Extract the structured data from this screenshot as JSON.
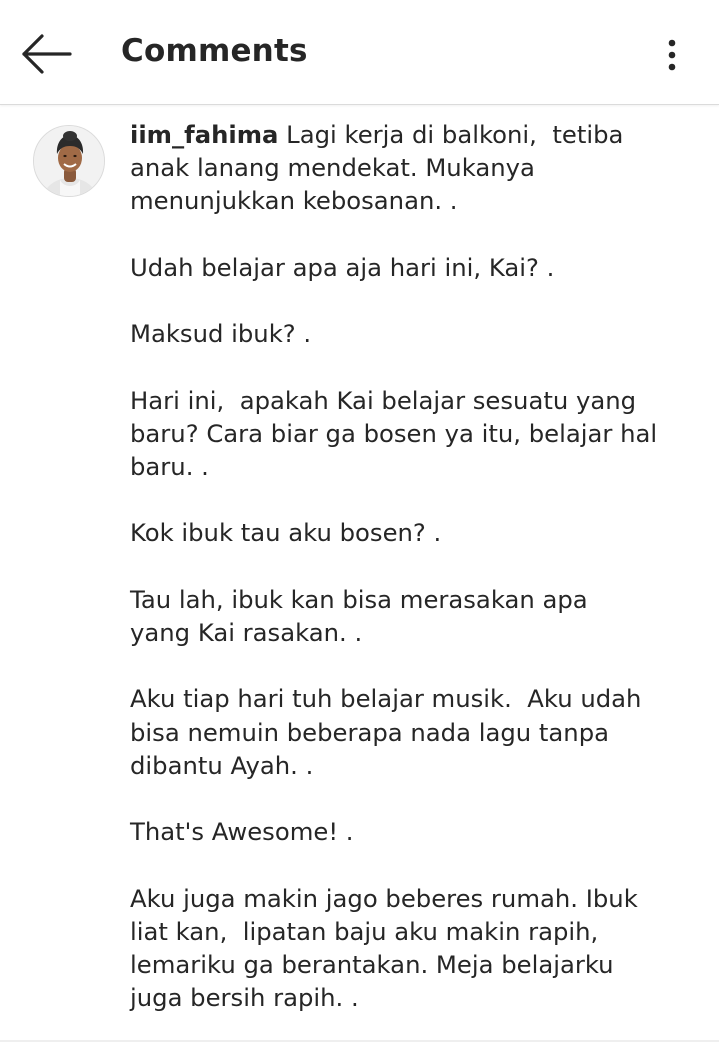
{
  "header": {
    "title": "Comments",
    "back_icon": "arrow-left-icon",
    "more_icon": "more-vertical-icon"
  },
  "comment": {
    "avatar_icon": "profile-avatar",
    "username": "iim_fahima",
    "lines": [
      "Lagi kerja di balkoni,  tetiba",
      "anak lanang mendekat. Mukanya",
      "menunjukkan kebosanan. .",
      "",
      "Udah belajar apa aja hari ini, Kai? .",
      "",
      "Maksud ibuk? .",
      "",
      "Hari ini,  apakah Kai belajar sesuatu yang",
      "baru? Cara biar ga bosen ya itu, belajar hal",
      "baru. .",
      "",
      "Kok ibuk tau aku bosen? .",
      "",
      "Tau lah, ibuk kan bisa merasakan apa",
      "yang Kai rasakan. .",
      "",
      "Aku tiap hari tuh belajar musik.  Aku udah",
      "bisa nemuin beberapa nada lagu tanpa",
      "dibantu Ayah. .",
      "",
      "That's Awesome! .",
      "",
      "Aku juga makin jago beberes rumah. Ibuk",
      "liat kan,  lipatan baju aku makin rapih,",
      "lemariku ga berantakan. Meja belajarku",
      "juga bersih rapih. ."
    ]
  },
  "colors": {
    "text": "#262626",
    "divider": "#dbdbdb",
    "background": "#ffffff"
  }
}
